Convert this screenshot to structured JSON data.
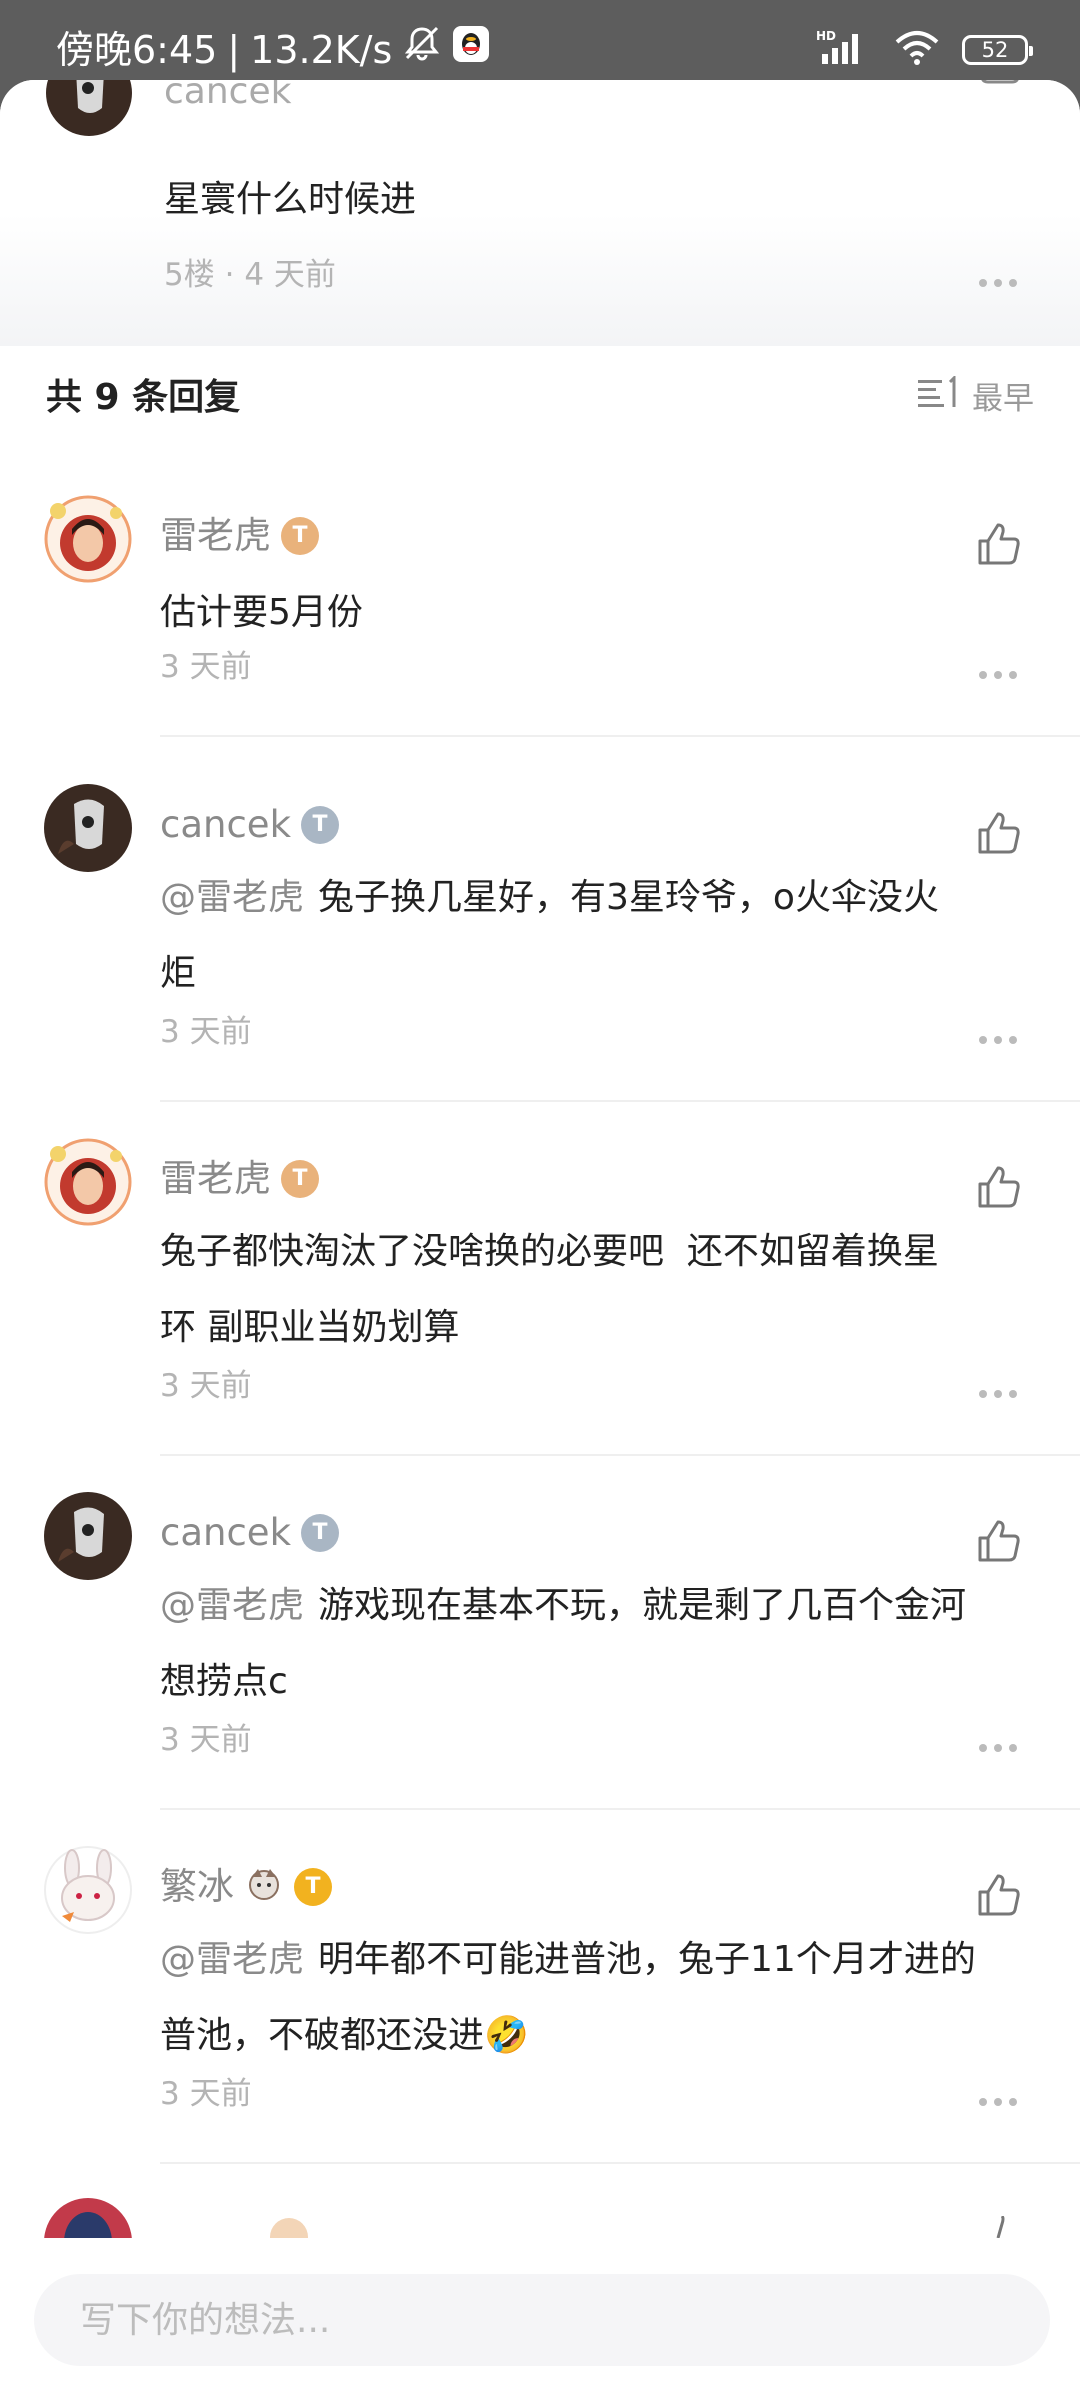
{
  "status_bar": {
    "time": "傍晚6:45",
    "net_speed": "13.2K/s",
    "hd_label": "HD",
    "battery": "52"
  },
  "parent_comment": {
    "username": "cancek",
    "content": "星寰什么时候进",
    "floor": "5楼",
    "time": "4 天前"
  },
  "reply_header": {
    "count_label": "共 9 条回复",
    "sort_label": "最早"
  },
  "replies": [
    {
      "username": "雷老虎",
      "badge_level": "4",
      "content": "估计要5月份",
      "time": "3 天前"
    },
    {
      "username": "cancek",
      "badge_level": "2",
      "mention": "@雷老虎",
      "content_line1": "兔子换几星好，有3星玲爷，o火伞没火",
      "content_line2": "炬",
      "time": "3 天前"
    },
    {
      "username": "雷老虎",
      "badge_level": "4",
      "content_line1": "兔子都快淘汰了没啥换的必要吧  还不如留着换星",
      "content_line2": "环 副职业当奶划算",
      "time": "3 天前"
    },
    {
      "username": "cancek",
      "badge_level": "2",
      "mention": "@雷老虎",
      "content_line1": "游戏现在基本不玩，就是剩了几百个金河",
      "content_line2": "想捞点c",
      "time": "3 天前"
    },
    {
      "username": "繁冰",
      "badge_level": "1",
      "mention": "@雷老虎",
      "content_line1": "明年都不可能进普池，兔子11个月才进的",
      "content_line2": "普池，不破都还没进",
      "emoji": "🤣",
      "time": "3 天前"
    }
  ],
  "composer": {
    "placeholder": "写下你的想法..."
  },
  "colors": {
    "status_bar_bg": "#5d5d5d",
    "badge_bronze": "#e9b27b",
    "badge_silver": "#a9b6c4",
    "badge_gold": "#f2b21f",
    "text_primary": "#222222",
    "text_secondary": "#8a8a8a"
  },
  "icons": {
    "like": "thumbs-up-icon",
    "more": "more-dots-icon",
    "sort": "sort-lines-icon",
    "qq": "qq-penguin-icon",
    "mute": "bell-off-icon",
    "signal": "signal-icon",
    "wifi": "wifi-icon"
  }
}
